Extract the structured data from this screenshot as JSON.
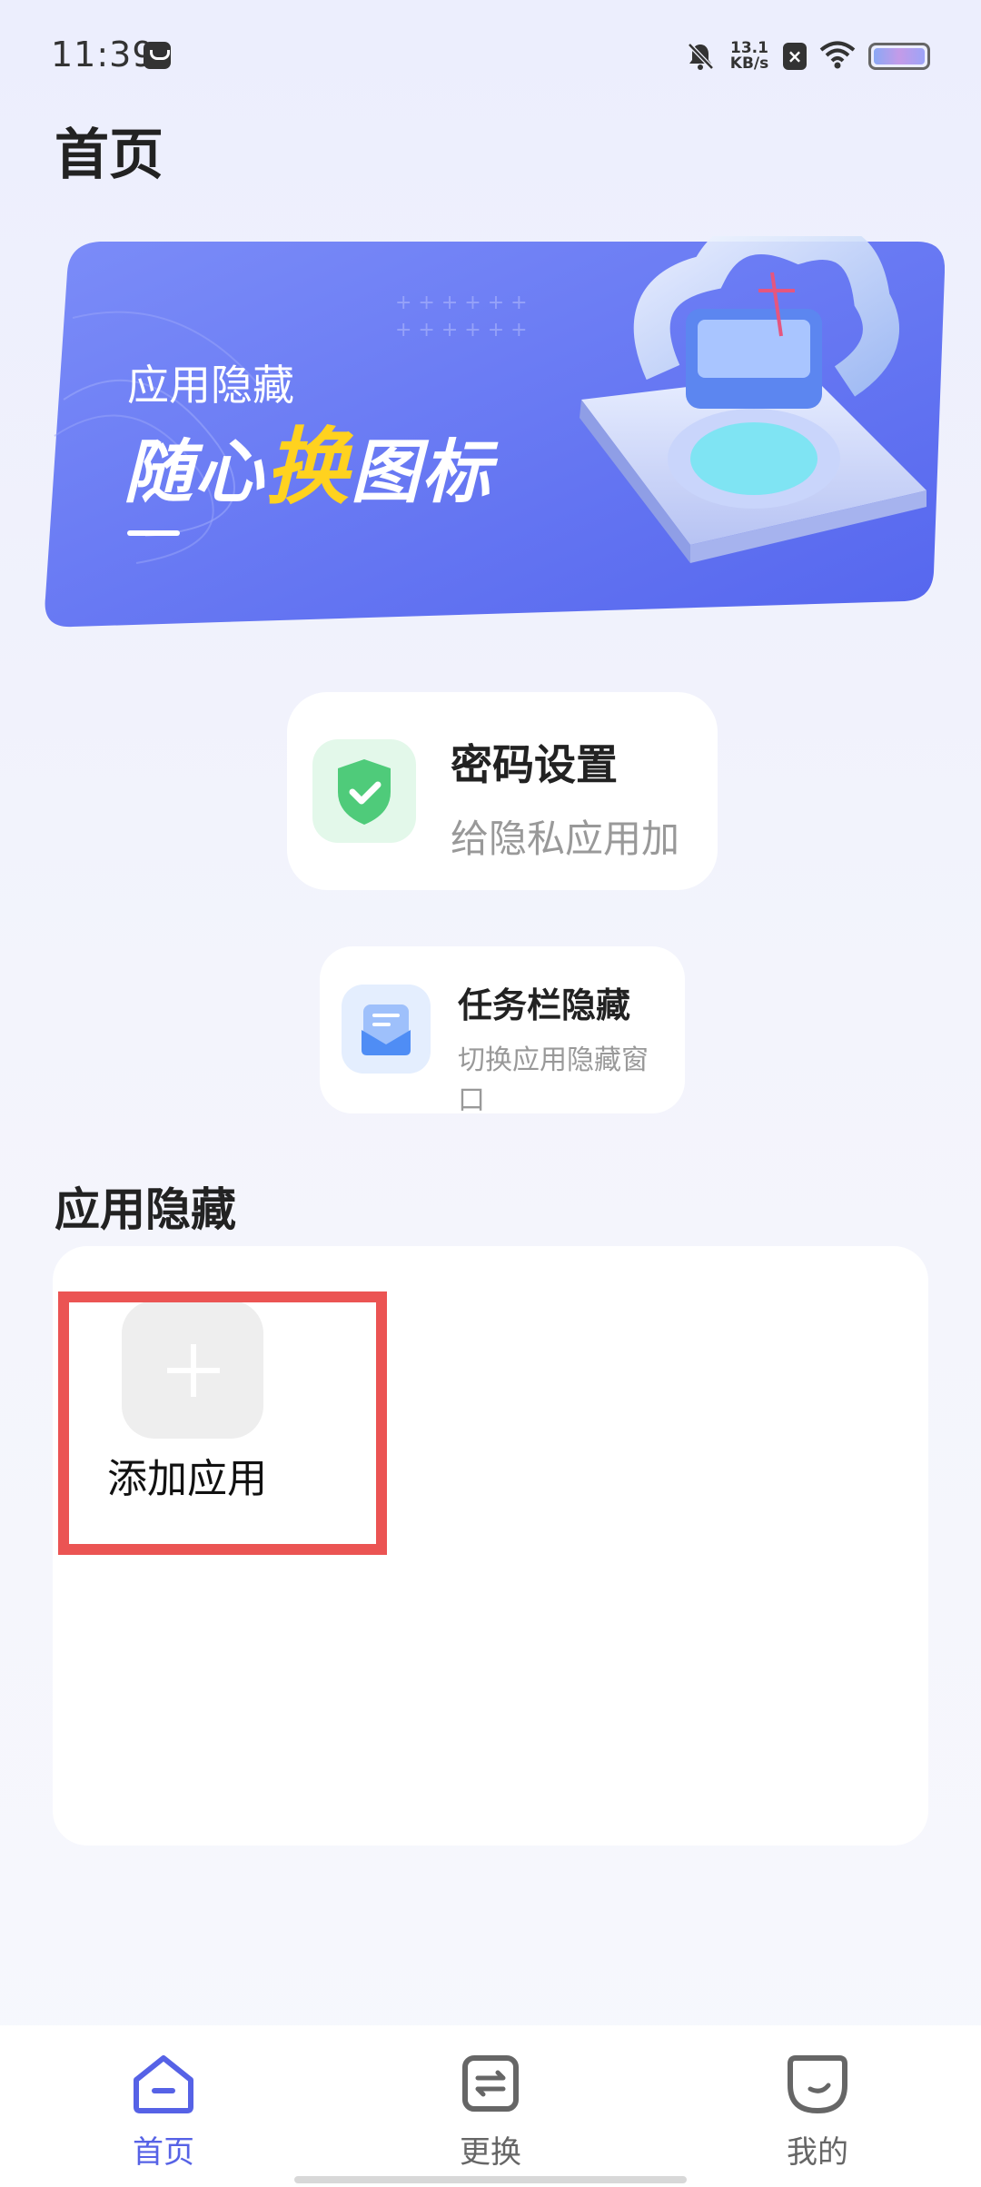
{
  "status_bar": {
    "time": "11:39",
    "net_speed_value": "13.1",
    "net_speed_unit": "KB/s"
  },
  "page": {
    "title": "首页"
  },
  "banner": {
    "subtitle": "应用隐藏",
    "headline_part1": "随心",
    "headline_highlight": "换",
    "headline_part2": "图标"
  },
  "cards": {
    "password": {
      "title": "密码设置",
      "subtitle": "给隐私应用加"
    },
    "taskbar": {
      "title": "任务栏隐藏",
      "subtitle": "切换应用隐藏窗口"
    }
  },
  "app_hide": {
    "section_title": "应用隐藏",
    "add_label": "添加应用"
  },
  "bottom_nav": {
    "items": [
      {
        "label": "首页",
        "icon": "home-icon",
        "active": true
      },
      {
        "label": "更换",
        "icon": "swap-icon",
        "active": false
      },
      {
        "label": "我的",
        "icon": "profile-face-icon",
        "active": false
      }
    ]
  },
  "colors": {
    "accent": "#5662E6",
    "banner": "#6A78F5",
    "highlight_box": "#EB5453",
    "headline_highlight": "#FFD21F"
  }
}
